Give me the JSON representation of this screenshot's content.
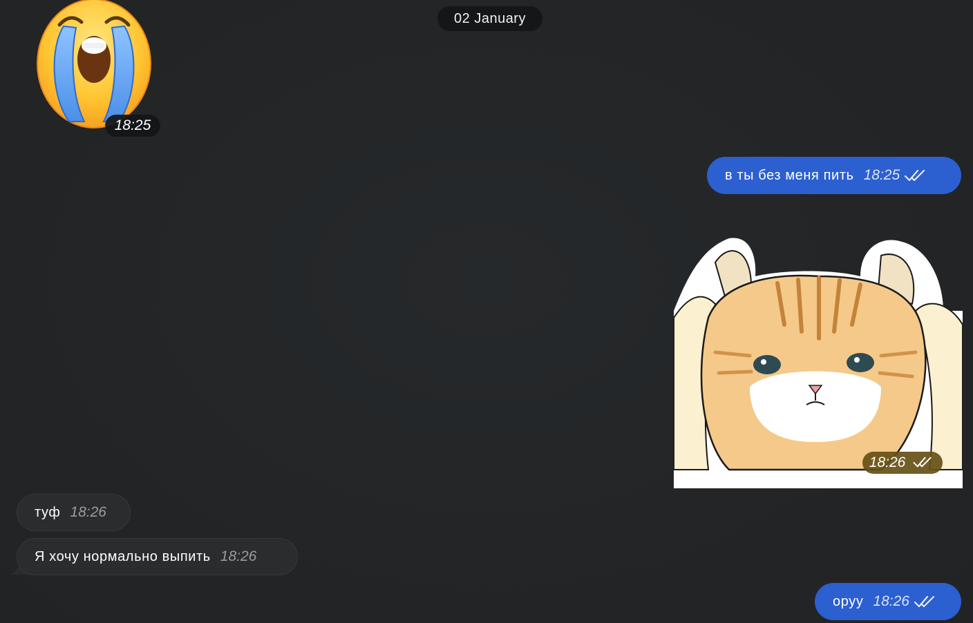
{
  "date_separator": "02 January",
  "messages": [
    {
      "type": "sticker",
      "side": "in",
      "sticker": "crying-face-emoji",
      "time": "18:25"
    },
    {
      "type": "text",
      "side": "out",
      "text": "в ты без меня пить",
      "time": "18:25",
      "status": "read-double-check-icon"
    },
    {
      "type": "sticker",
      "side": "out",
      "sticker": "cat-covering-ears",
      "time": "18:26",
      "status": "read-double-check-icon"
    },
    {
      "type": "text",
      "side": "in",
      "text": "туф",
      "time": "18:26"
    },
    {
      "type": "text",
      "side": "in",
      "text": "Я хочу нормально выпить",
      "time": "18:26"
    },
    {
      "type": "text",
      "side": "out",
      "text": "оруу",
      "time": "18:26",
      "status": "read-double-check-icon"
    }
  ],
  "colors": {
    "background": "#222426",
    "outgoing_bubble": "#2c5fd0",
    "incoming_bubble": "#2a2c2e",
    "date_pill": "#141617"
  }
}
